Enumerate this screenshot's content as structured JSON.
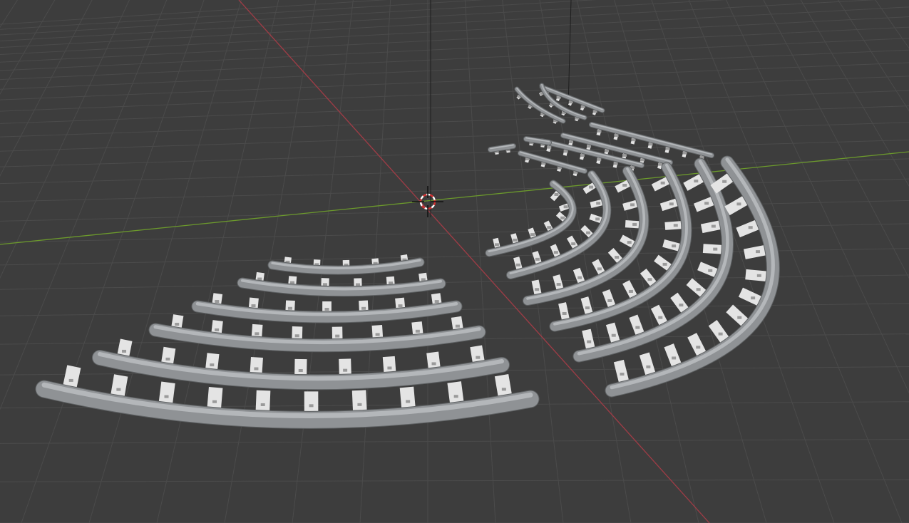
{
  "viewport": {
    "background": "#3d3d3d",
    "grid_color": "#4b4b4b",
    "x_axis_color": "#a03c46",
    "y_axis_color": "#6c9a2c",
    "z_line_color": "#1e1e1e",
    "rail_color": "#8f9295",
    "rail_highlight": "#b4b7ba",
    "tie_color": "#e4e4e4",
    "cursor_color": "#d23232"
  },
  "scene": {
    "objects": [
      "curved-track-set-left",
      "curved-track-set-right",
      "track-switch-pieces"
    ]
  }
}
